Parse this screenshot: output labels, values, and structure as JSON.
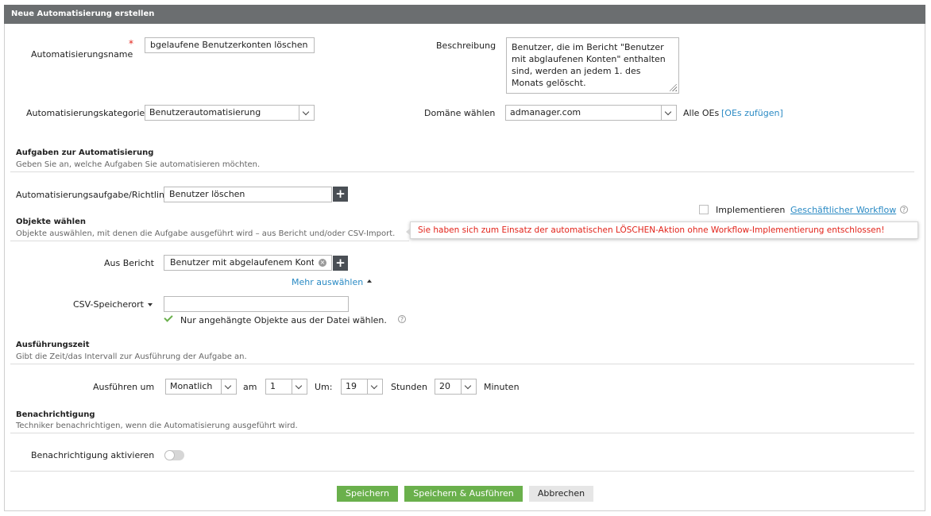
{
  "window": {
    "title": "Neue Automatisierung erstellen"
  },
  "general": {
    "name_label": "Automatisierungsname",
    "required_mark": "*",
    "name_value": "bgelaufene Benutzerkonten löschen",
    "description_label": "Beschreibung",
    "description_value": "Benutzer, die im Bericht \"Benutzer mit abglaufenen Konten\" enthalten sind, werden an jedem 1. des Monats gelöscht.",
    "category_label": "Automatisierungskategorie",
    "category_value": "Benutzerautomatisierung",
    "domain_label": "Domäne wählen",
    "domain_value": "admanager.com",
    "ou_all": "Alle OEs",
    "ou_add_link": "[OEs zufügen]"
  },
  "tasks": {
    "title": "Aufgaben zur Automatisierung",
    "subtitle": "Geben Sie an, welche Aufgaben Sie automatisieren möchten.",
    "task_label": "Automatisierungsaufgabe/Richtlinie",
    "task_value": "Benutzer löschen",
    "plus": "+",
    "implement_label": "Implementieren",
    "workflow_link": "Geschäftlicher Workflow",
    "help": "?"
  },
  "objects": {
    "title": "Objekte wählen",
    "subtitle": "Objekte auswählen, mit denen die Aufgabe ausgeführt wird – aus Bericht und/oder CSV-Import.",
    "warning": "Sie haben sich zum Einsatz der automatischen LÖSCHEN-Aktion ohne Workflow-Implementierung entschlossen!",
    "report_label": "Aus Bericht",
    "report_value": "Benutzer mit abgelaufenem Konto",
    "remove": "×",
    "more_link": "Mehr auswählen",
    "csv_label": "CSV-Speicherort",
    "csv_value": "",
    "only_attached_label": "Nur angehängte Objekte aus der Datei wählen."
  },
  "schedule": {
    "title": "Ausführungszeit",
    "subtitle": "Gibt die Zeit/das Intervall zur Ausführung der Aufgabe an.",
    "run_label": "Ausführen um",
    "frequency": "Monatlich",
    "am_label": "am",
    "day": "1",
    "um_label": "Um:",
    "hour": "19",
    "hours_label": "Stunden",
    "minute": "20",
    "minutes_label": "Minuten"
  },
  "notification": {
    "title": "Benachrichtigung",
    "subtitle": "Techniker benachrichtigen, wenn die Automatisierung ausgeführt wird.",
    "enable_label": "Benachrichtigung aktivieren",
    "enabled": false
  },
  "actions": {
    "save": "Speichern",
    "save_run": "Speichern & Ausführen",
    "cancel": "Abbrechen"
  }
}
